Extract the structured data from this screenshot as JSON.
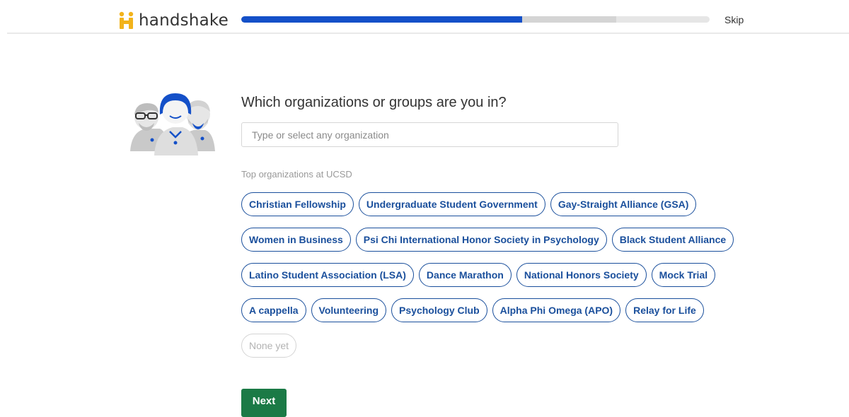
{
  "header": {
    "logo_text": "handshake",
    "logo_icon": "handshake-h-icon",
    "skip_label": "Skip",
    "progress": {
      "completed_fraction": 0.6,
      "secondary_fraction": 0.8
    },
    "colors": {
      "progress_fill": "#1450c8",
      "progress_secondary": "#d4d4d4",
      "logo_accent": "#f2b31b"
    }
  },
  "illustration": {
    "icon": "people-group-icon"
  },
  "main": {
    "question": "Which organizations or groups are you in?",
    "search_placeholder": "Type or select any organization",
    "search_value": "",
    "section_label": "Top organizations at UCSD",
    "organizations": [
      [
        "Christian Fellowship",
        "Undergraduate Student Government",
        "Gay-Straight Alliance (GSA)"
      ],
      [
        "Women in Business",
        "Psi Chi International Honor Society in Psychology",
        "Black Student Alliance"
      ],
      [
        "Latino Student Association (LSA)",
        "Dance Marathon",
        "National Honors Society",
        "Mock Trial"
      ],
      [
        "A cappella",
        "Volunteering",
        "Psychology Club",
        "Alpha Phi Omega (APO)",
        "Relay for Life"
      ]
    ],
    "none_label": "None yet",
    "next_label": "Next",
    "colors": {
      "chip_border": "#1a4f9c",
      "next_button": "#1b7a46"
    }
  }
}
